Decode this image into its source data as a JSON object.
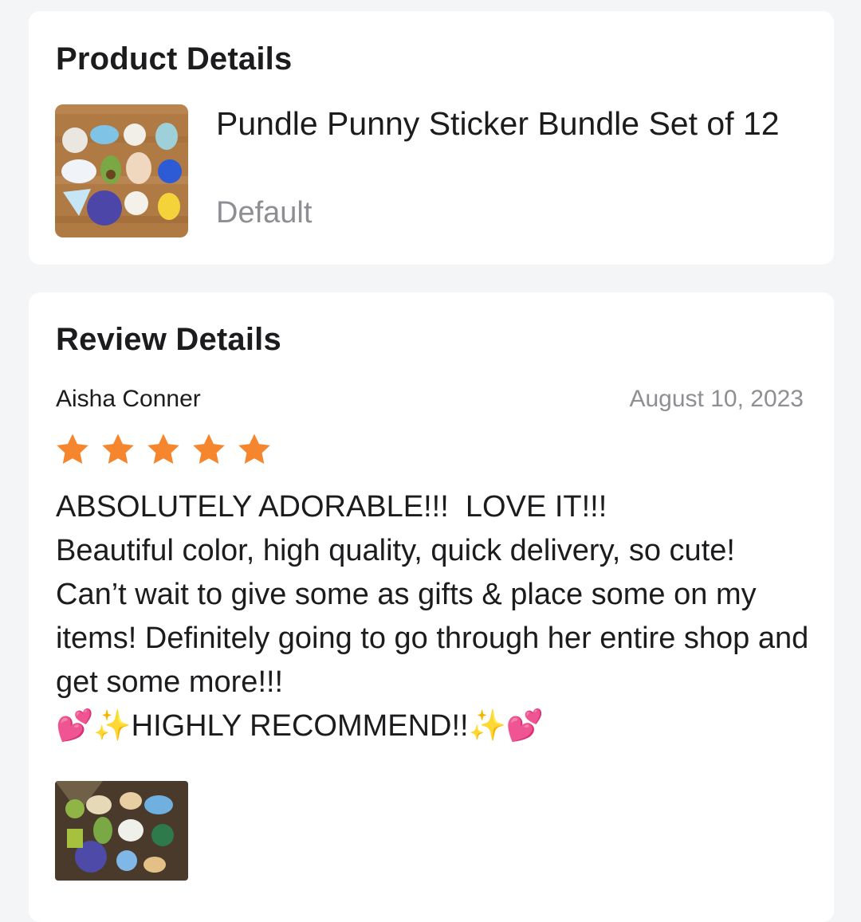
{
  "product": {
    "section_title": "Product Details",
    "name": "Pundle Punny Sticker Bundle Set of 12",
    "variant": "Default"
  },
  "review": {
    "section_title": "Review Details",
    "reviewer": "Aisha Conner",
    "date": "August 10, 2023",
    "rating": 5,
    "rating_max": 5,
    "star_color": "#f5862e",
    "text": "ABSOLUTELY ADORABLE!!!  LOVE IT!!!\nBeautiful color, high quality, quick delivery, so cute!  Can’t wait to give some as gifts & place some on my items! Definitely going to go through her entire shop and get some more!!!\n💕✨HIGHLY RECOMMEND!!✨💕"
  },
  "images": {
    "product_photo": "sticker-bundle-photo",
    "review_photo": "customer-sticker-photo"
  }
}
